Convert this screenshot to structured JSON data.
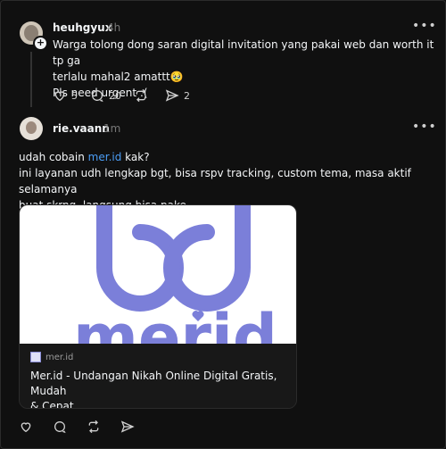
{
  "post1": {
    "username": "heuhgyux",
    "time": "4h",
    "lines": [
      "Warga tolong dong saran digital invitation yang pakai web dan worth it tp ga",
      "terlalu mahal2 amattt🥹",
      "Pls need urgent :("
    ],
    "likes": "5",
    "comments": "20",
    "shares": "2"
  },
  "post2": {
    "username": "rie.vaann",
    "time": "1m",
    "line1_pre": "udah cobain ",
    "line1_link": "mer.id",
    "line1_post": " kak?",
    "line2": "ini layanan udh lengkap bgt, bisa rspv tracking, custom tema, masa aktif selamanya",
    "line3": "buat skrng, langsung bisa pake"
  },
  "card": {
    "domain": "mer.id",
    "title_line1": "Mer.id - Undangan Nikah Online Digital Gratis, Mudah",
    "title_line2": "& Cepat",
    "logo_text": "merid"
  },
  "more_label": "•••",
  "colors": {
    "background": "#101010",
    "text": "#f3f5f7",
    "muted": "#777777",
    "link": "#4b9df5",
    "logo": "#7b7fd9"
  }
}
